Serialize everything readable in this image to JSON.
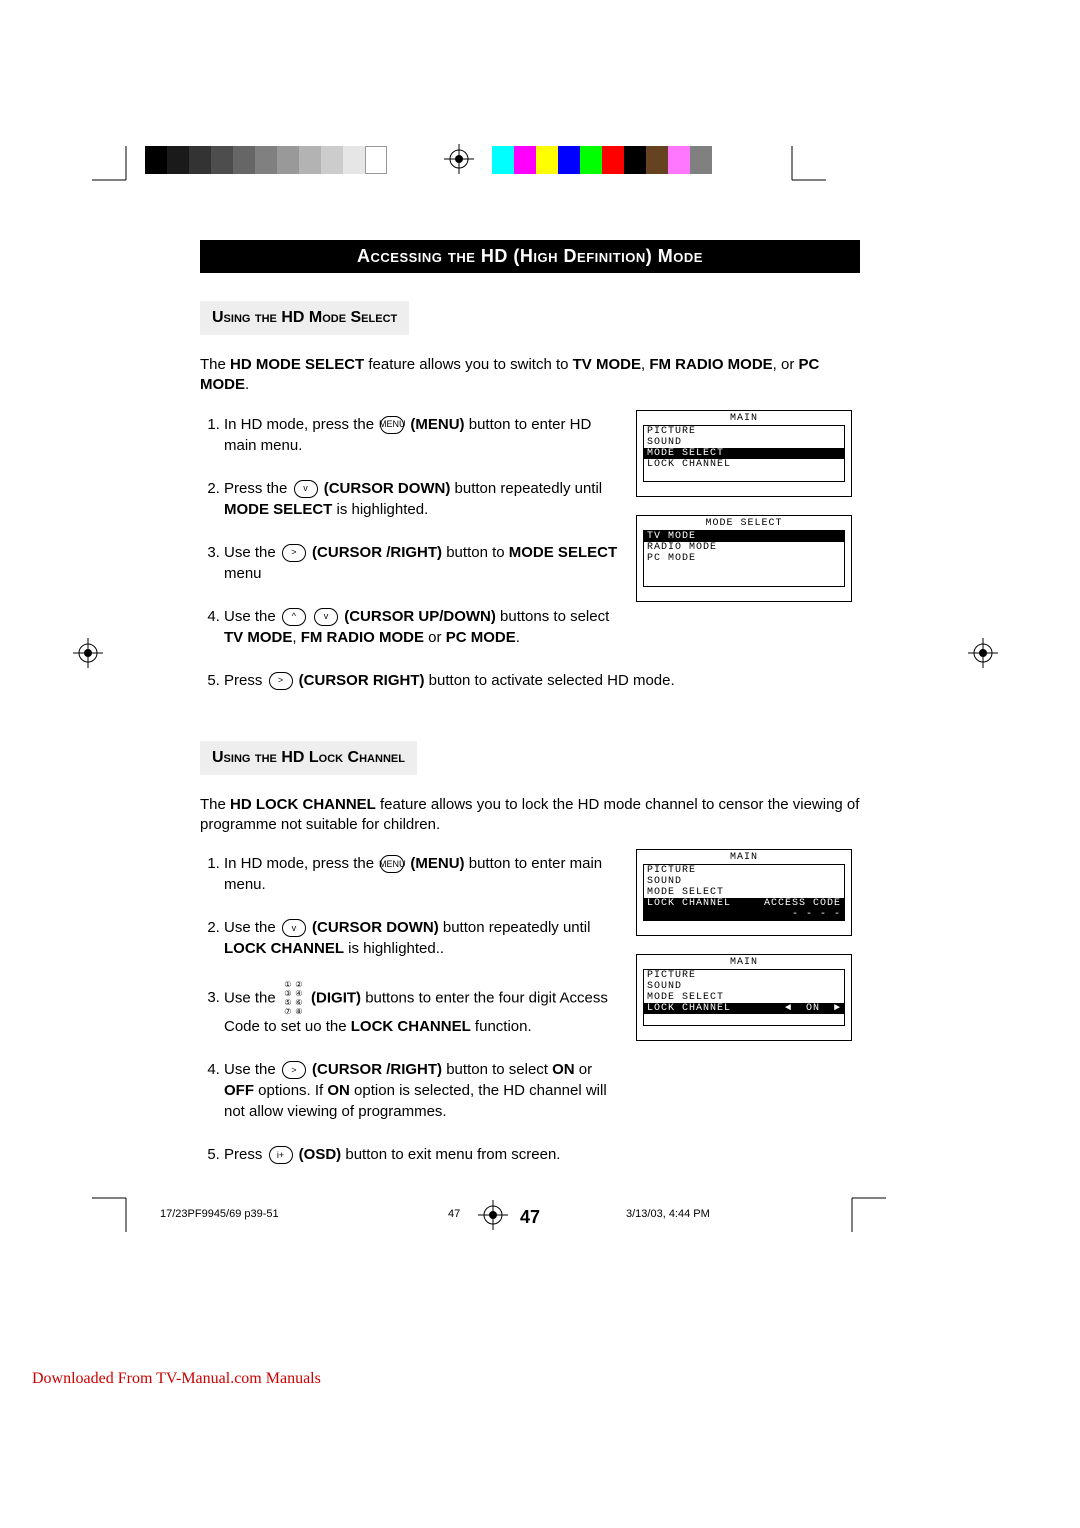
{
  "title": "Accessing the HD (High Definition) Mode",
  "section_a": {
    "heading": "Using the HD Mode Select",
    "intro_pre": "The ",
    "intro_b1": "HD MODE SELECT",
    "intro_mid": " feature allows you to switch to ",
    "intro_b2": "TV MODE",
    "intro_sep1": ", ",
    "intro_b3": "FM RADIO MODE",
    "intro_sep2": ", or ",
    "intro_b4": "PC MODE",
    "intro_end": ".",
    "step1_a": "In HD mode, press the ",
    "step1_btn": "MENU",
    "step1_b": " (MENU)",
    "step1_c": " button to enter HD main menu.",
    "step2_a": "Press the ",
    "step2_btn": "v",
    "step2_b": " (CURSOR DOWN)",
    "step2_c": "  button repeatedly until ",
    "step2_d": "MODE SELECT",
    "step2_e": " is highlighted.",
    "step3_a": "Use the  ",
    "step3_btn": ">",
    "step3_b": " (CURSOR /RIGHT)",
    "step3_c": " button to ",
    "step3_d": "MODE SELECT",
    "step3_e": " menu",
    "step4_a": "Use the ",
    "step4_btn1": "^",
    "step4_btn2": "v",
    "step4_b": " (CURSOR UP/DOWN)",
    "step4_c": "  buttons to select ",
    "step4_d": "TV MODE",
    "step4_sep1": ", ",
    "step4_e": "FM RADIO MODE",
    "step4_sep2": " or ",
    "step4_f": "PC MODE",
    "step4_end": ".",
    "step5_a": "Press ",
    "step5_btn": ">",
    "step5_b": " (CURSOR RIGHT)",
    "step5_c": " button to activate selected HD mode."
  },
  "section_b": {
    "heading": "Using the HD Lock Channel",
    "intro_pre": "The ",
    "intro_b1": "HD LOCK CHANNEL",
    "intro_mid": " feature allows you to lock the HD mode channel to censor the viewing of programme not suitable for children.",
    "step1_a": "In HD mode,  press the ",
    "step1_btn": "MENU",
    "step1_b": " (MENU)",
    "step1_c": " button to enter main menu.",
    "step2_a": "Use the ",
    "step2_btn": "v",
    "step2_b": " (CURSOR DOWN)",
    "step2_c": " button repeatedly until  ",
    "step2_d": "LOCK CHANNEL",
    "step2_e": " is highlighted..",
    "step3_a": "Use the ",
    "step3_b": " (DIGIT)",
    "step3_c": " buttons to enter the four digit Access Code to set uo the ",
    "step3_d": "LOCK CHANNEL",
    "step3_e": " function.",
    "step4_a": "Use the ",
    "step4_btn": ">",
    "step4_b": " (CURSOR /RIGHT)",
    "step4_c": "  button to select ",
    "step4_d": "ON",
    "step4_sep1": " or ",
    "step4_e": "OFF",
    "step4_f": " options. If ",
    "step4_g": "ON",
    "step4_h": " option is selected, the HD channel will not allow viewing of programmes.",
    "step5_a": "Press ",
    "step5_btn": "i+",
    "step5_b": " (OSD)",
    "step5_c": " button to exit menu from screen."
  },
  "osd": {
    "main_title": "MAIN",
    "picture": "PICTURE",
    "sound": "SOUND",
    "mode_select": "MODE SELECT",
    "lock_channel": "LOCK CHANNEL",
    "ms_title": "MODE SELECT",
    "tv_mode": "TV MODE",
    "radio_mode": "RADIO MODE",
    "pc_mode": "PC MODE",
    "access_code": "ACCESS CODE",
    "dashes": "- - - -",
    "on_opt": "◄  ON  ►"
  },
  "page_number": "47",
  "footer": {
    "left": "17/23PF9945/69 p39-51",
    "mid": "47",
    "right": "3/13/03, 4:44 PM"
  },
  "download_note": "Downloaded From TV-Manual.com Manuals",
  "colors": {
    "left_bar": [
      "#000000",
      "#1a1a1a",
      "#333333",
      "#4d4d4d",
      "#666666",
      "#808080",
      "#999999",
      "#b3b3b3",
      "#cccccc",
      "#e6e6e6",
      "#ffffff"
    ],
    "right_bar": [
      "#00ffff",
      "#ff00ff",
      "#ffff00",
      "#0000ff",
      "#00ff00",
      "#ff0000",
      "#000000",
      "#654321",
      "#ff77ff",
      "#808080"
    ]
  }
}
